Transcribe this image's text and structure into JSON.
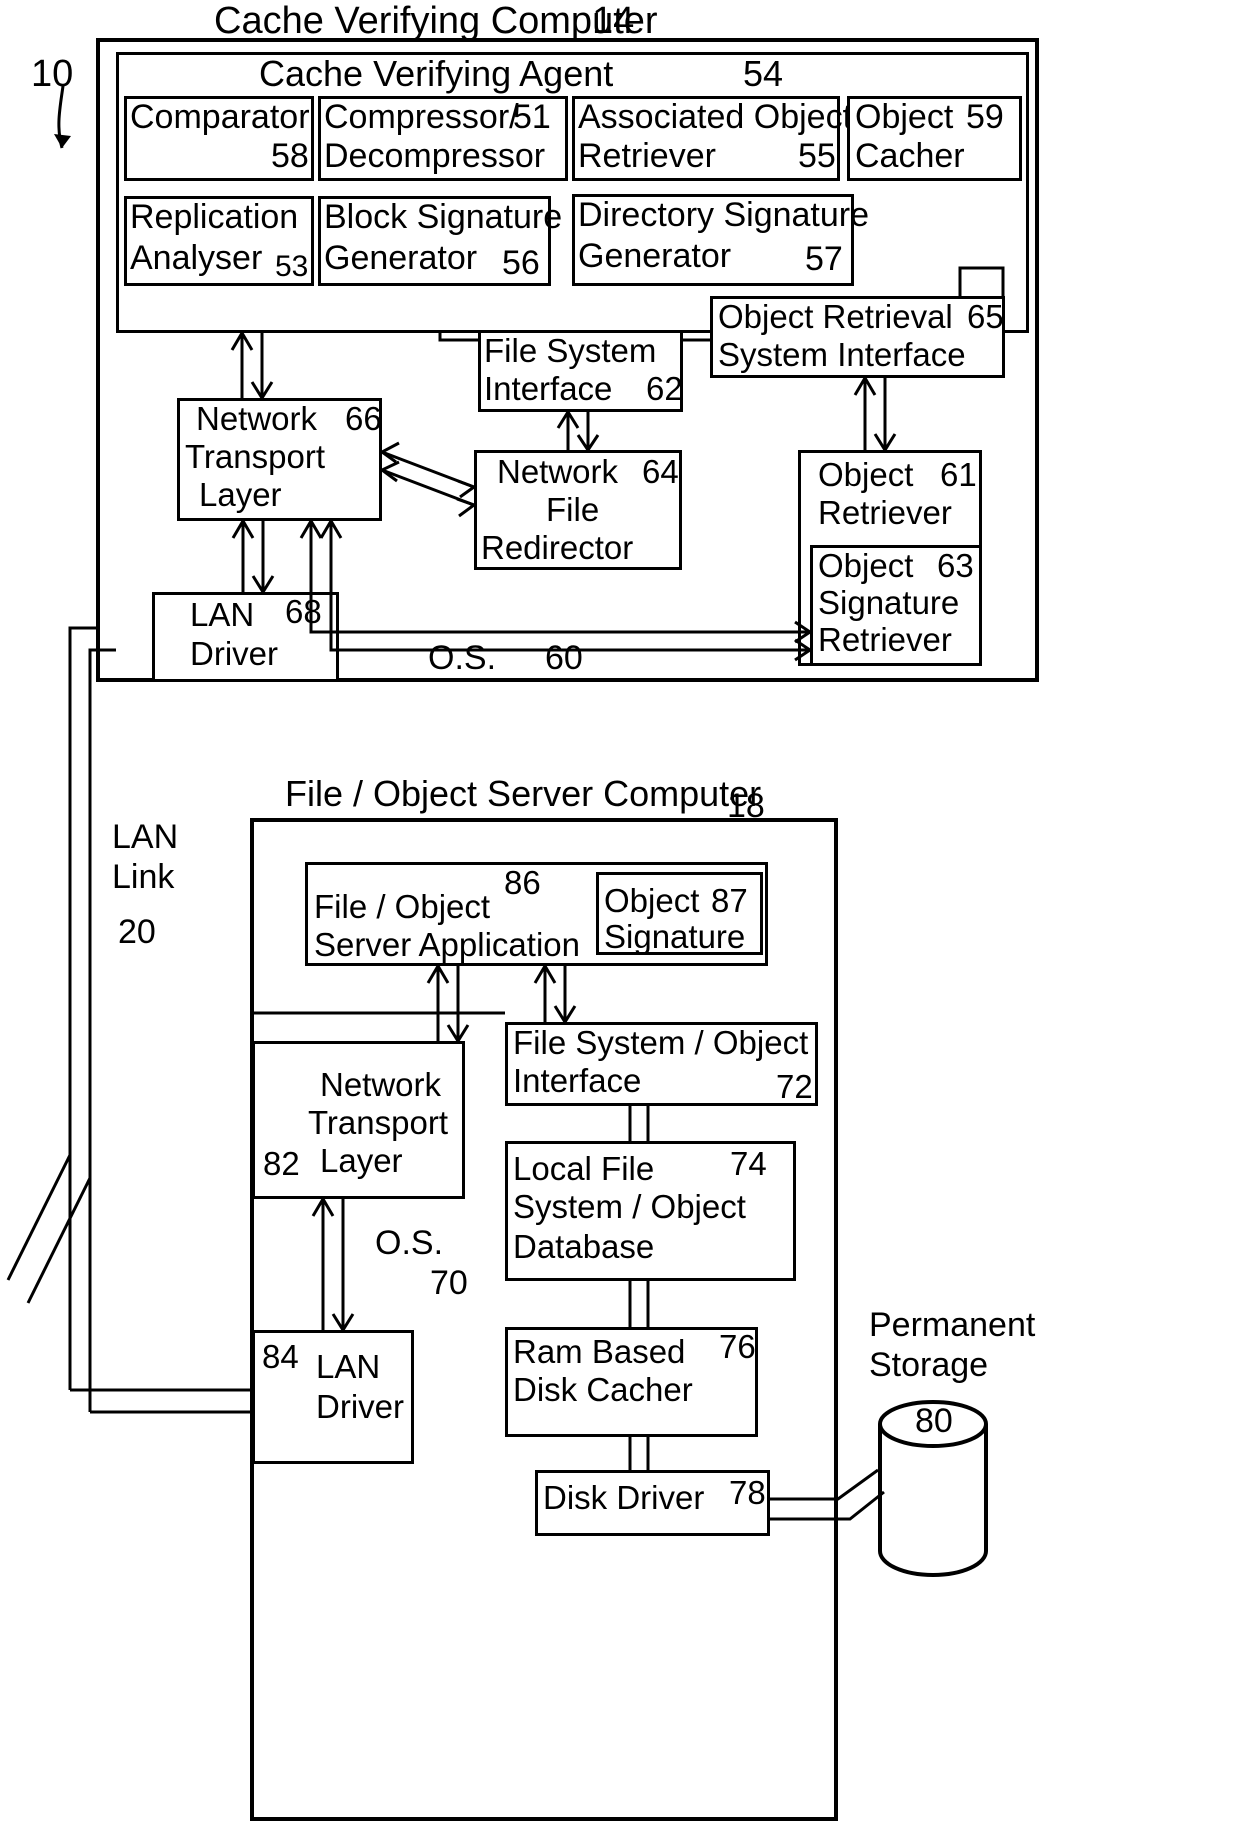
{
  "figure": {
    "lead_number": "10",
    "top_system": {
      "title": "Cache Verifying Computer",
      "title_ref": "14",
      "agent": {
        "title": "Cache Verifying Agent",
        "ref": "54"
      },
      "agent_blocks": [
        {
          "name": "Comparator",
          "ref": "58"
        },
        {
          "name_line1": "Compressor/",
          "name_line2": "Decompressor",
          "ref": "51"
        },
        {
          "name_line1": "Associated Object",
          "name_line2": "Retriever",
          "ref": "55"
        },
        {
          "name_line1": "Object",
          "name_line2": "Cacher",
          "ref": "59"
        },
        {
          "name_line1": "Replication",
          "name_line2": "Analyser",
          "ref": "53"
        },
        {
          "name_line1": "Block Signature",
          "name_line2": "Generator",
          "ref": "56"
        },
        {
          "name_line1": "Directory Signature",
          "name_line2": "Generator",
          "ref": "57"
        }
      ],
      "os": {
        "label": "O.S.",
        "ref": "60"
      },
      "os_blocks": [
        {
          "name_line1": "File System",
          "name_line2": "Interface",
          "ref": "62"
        },
        {
          "name_line1": "Object Retrieval",
          "name_line2": "System Interface",
          "ref": "65"
        },
        {
          "name_line1": "Network",
          "name_line2": "Transport",
          "name_line3": "Layer",
          "ref": "66"
        },
        {
          "name_line1": "Network",
          "name_line2": "File",
          "name_line3": "Redirector",
          "ref": "64"
        },
        {
          "name_line1": "Object",
          "name_line2": "Retriever",
          "ref": "61"
        },
        {
          "name_line1": "Object",
          "name_line2": "Signature",
          "name_line3": "Retriever",
          "ref": "63"
        },
        {
          "name_line1": "LAN",
          "name_line2": "Driver",
          "ref": "68"
        }
      ]
    },
    "lan": {
      "line1": "LAN",
      "line2": "Link",
      "ref": "20"
    },
    "bottom_system": {
      "title": "File / Object Server Computer",
      "title_ref": "18",
      "os": {
        "label": "O.S.",
        "ref": "70"
      },
      "blocks": [
        {
          "name_line1": "File / Object",
          "name_line2": "Server Application",
          "ref": "86"
        },
        {
          "name_line1": "Object",
          "name_line2": "Signature",
          "ref": "87"
        },
        {
          "name_line1": "File System / Object",
          "name_line2": "Interface",
          "ref": "72"
        },
        {
          "name_line1": "Network",
          "name_line2": "Transport",
          "name_line3": "Layer",
          "ref": "82"
        },
        {
          "name_line1": "Local File",
          "name_line2": "System / Object",
          "name_line3": "Database",
          "ref": "74"
        },
        {
          "name_line1": "LAN",
          "name_line2": "Driver",
          "ref": "84"
        },
        {
          "name_line1": "Ram Based",
          "name_line2": "Disk Cacher",
          "ref": "76"
        },
        {
          "name": "Disk Driver",
          "ref": "78"
        }
      ],
      "storage": {
        "line1": "Permanent",
        "line2": "Storage",
        "ref": "80"
      }
    }
  },
  "colors": {
    "ink": "#000000",
    "paper": "#ffffff"
  }
}
